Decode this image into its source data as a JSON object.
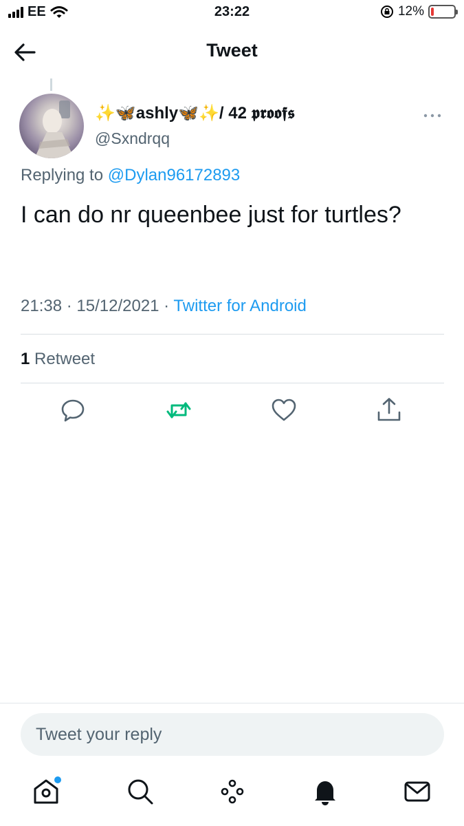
{
  "status_bar": {
    "carrier": "EE",
    "time": "23:22",
    "battery": "12%",
    "battery_level": 0.12
  },
  "header": {
    "title": "Tweet"
  },
  "tweet": {
    "display_name": "✨🦋ashly🦋✨/ 42 𝖕𝖗𝖔𝖔𝖋𝖘",
    "handle": "@Sxndrqq",
    "replying_prefix": "Replying to ",
    "replying_to": "@Dylan96172893",
    "text": "I can do nr queenbee just for turtles?",
    "time": "21:38",
    "date": "15/12/2021",
    "separator": " · ",
    "source": "Twitter for Android",
    "retweet_count": "1",
    "retweet_label": " Retweet"
  },
  "reply": {
    "placeholder": "Tweet your reply"
  },
  "colors": {
    "accent": "#1d9bf0",
    "retweet_green": "#00ba7c",
    "secondary_text": "#536471"
  },
  "icons": {
    "back": "arrow-left-icon",
    "more": "more-icon",
    "actions": [
      "reply-icon",
      "retweet-icon",
      "like-icon",
      "share-icon"
    ],
    "tabs": [
      "home-icon",
      "search-icon",
      "spaces-icon",
      "notifications-icon",
      "messages-icon"
    ]
  }
}
